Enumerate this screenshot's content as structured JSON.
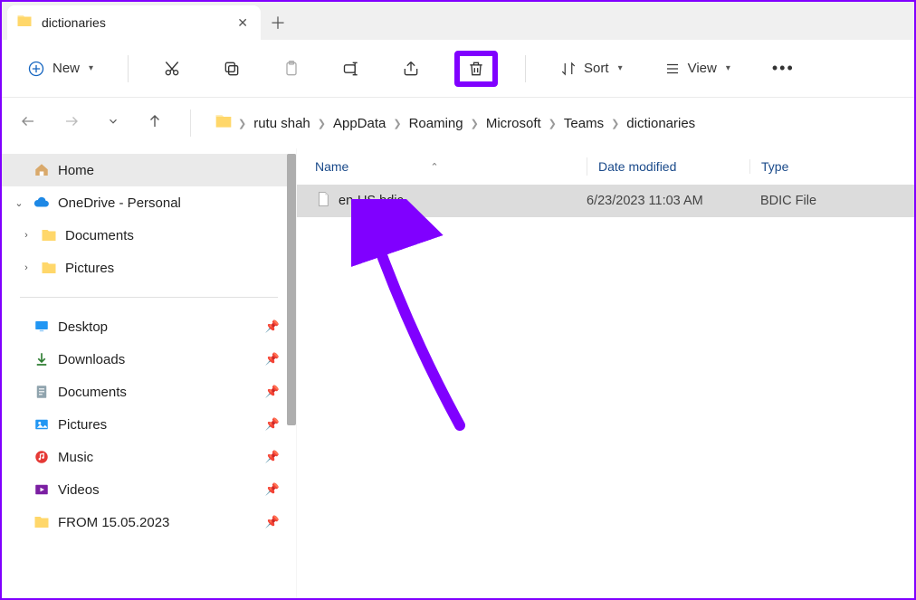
{
  "tab": {
    "title": "dictionaries"
  },
  "toolbar": {
    "new_label": "New",
    "sort_label": "Sort",
    "view_label": "View"
  },
  "breadcrumb": [
    "rutu shah",
    "AppData",
    "Roaming",
    "Microsoft",
    "Teams",
    "dictionaries"
  ],
  "sidebar": {
    "home": "Home",
    "onedrive": "OneDrive - Personal",
    "onedrive_children": [
      "Documents",
      "Pictures"
    ],
    "quick": [
      "Desktop",
      "Downloads",
      "Documents",
      "Pictures",
      "Music",
      "Videos",
      "FROM 15.05.2023"
    ]
  },
  "columns": {
    "name": "Name",
    "date": "Date modified",
    "type": "Type"
  },
  "files": [
    {
      "name": "en-US.bdic",
      "date": "6/23/2023 11:03 AM",
      "type": "BDIC File"
    }
  ]
}
